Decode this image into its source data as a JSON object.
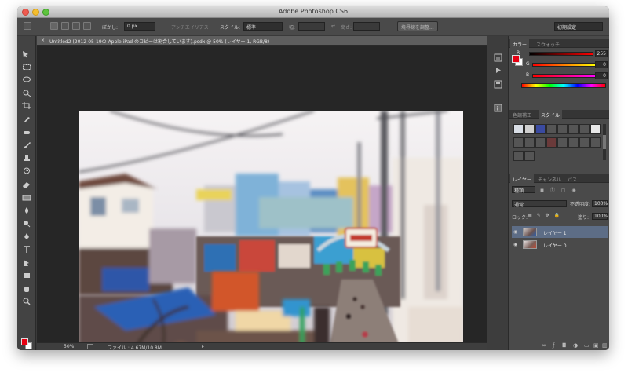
{
  "window": {
    "title": "Adobe Photoshop CS6"
  },
  "options_bar": {
    "feather_label": "ぼかし:",
    "feather_value": "0 px",
    "antialias_label": "アンチエイリアス",
    "style_label": "スタイル:",
    "style_value": "標準",
    "width_label": "幅:",
    "height_label": "高さ:",
    "refine_edge_label": "境界線を調整...",
    "workspace_label": "初期設定"
  },
  "document": {
    "tab_title": "Untitled2 (2012-05-19の Apple iPad のコピーは割合しています).psdx @ 50% (レイヤー 1, RGB/8)",
    "close_glyph": "×",
    "zoom_status": "50%",
    "file_label": "ファイル : 4.67M/10.8M"
  },
  "color_panel": {
    "tabs": [
      "カラー",
      "スウォッチ"
    ],
    "channels": [
      {
        "label": "R",
        "value": "255",
        "gradient": "linear-gradient(90deg,#000000,#ff0000)"
      },
      {
        "label": "G",
        "value": "0",
        "gradient": "linear-gradient(90deg,#ff0000,#ffff00)"
      },
      {
        "label": "B",
        "value": "0",
        "gradient": "linear-gradient(90deg,#ff0000,#ff00ff)"
      }
    ],
    "foreground": "#e60012",
    "background": "#ffffff"
  },
  "styles_panel": {
    "tabs": [
      "色調補正",
      "スタイル"
    ]
  },
  "layers_panel": {
    "tabs": [
      "レイヤー",
      "チャンネル",
      "パス"
    ],
    "kind_label": "種類",
    "blend_mode": "通常",
    "opacity_label": "不透明度:",
    "opacity_value": "100%",
    "lock_label": "ロック:",
    "fill_label": "塗り:",
    "fill_value": "100%",
    "layers": [
      {
        "name": "レイヤー 1",
        "selected": true
      },
      {
        "name": "レイヤー 0",
        "selected": false
      }
    ]
  },
  "icons": {
    "tools": [
      "move-icon",
      "marquee-icon",
      "lasso-icon",
      "quick-select-icon",
      "crop-icon",
      "eyedropper-icon",
      "healing-icon",
      "brush-icon",
      "stamp-icon",
      "history-brush-icon",
      "eraser-icon",
      "gradient-icon",
      "blur-icon",
      "dodge-icon",
      "pen-icon",
      "type-icon",
      "path-select-icon",
      "shape-icon",
      "hand-icon",
      "zoom-icon"
    ]
  }
}
